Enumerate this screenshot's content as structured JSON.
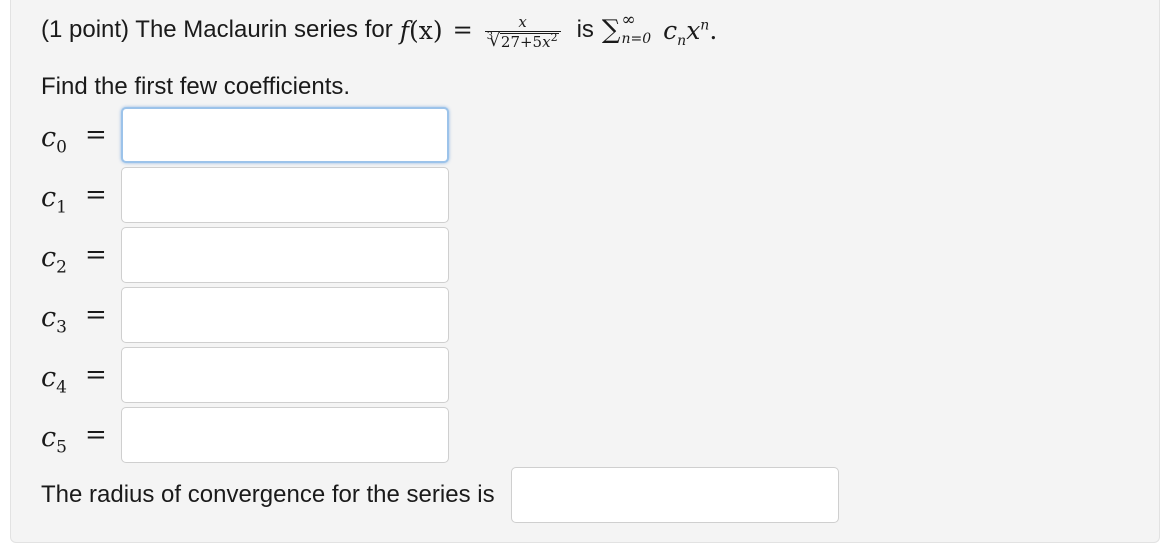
{
  "problem": {
    "prefix": "(1 point) The Maclaurin series for",
    "function_name": "f",
    "function_arg": "(x)",
    "equals": "=",
    "numerator": "x",
    "root_index": "3",
    "radical": "√",
    "radicand_const": "27+5",
    "radicand_var": "x",
    "radicand_power": "2",
    "word_is": "is",
    "sigma": "∑",
    "sum_upper": "∞",
    "sum_lower": "n=0",
    "term_coef": "c",
    "term_coef_sub": "n",
    "term_var": "x",
    "term_power": "n",
    "period": "."
  },
  "instruction": "Find the first few coefficients.",
  "coefficients": [
    {
      "symbol": "c",
      "index": "0",
      "equals": "=",
      "value": "",
      "placeholder": ""
    },
    {
      "symbol": "c",
      "index": "1",
      "equals": "=",
      "value": "",
      "placeholder": ""
    },
    {
      "symbol": "c",
      "index": "2",
      "equals": "=",
      "value": "",
      "placeholder": ""
    },
    {
      "symbol": "c",
      "index": "3",
      "equals": "=",
      "value": "",
      "placeholder": ""
    },
    {
      "symbol": "c",
      "index": "4",
      "equals": "=",
      "value": "",
      "placeholder": ""
    },
    {
      "symbol": "c",
      "index": "5",
      "equals": "=",
      "value": "",
      "placeholder": ""
    }
  ],
  "radius": {
    "label": "The radius of convergence for the series is",
    "value": "",
    "placeholder": ""
  },
  "colors": {
    "panel_background": "#f4f4f4",
    "input_border": "#cfcfcf",
    "focus_ring": "#9cc3ea"
  }
}
